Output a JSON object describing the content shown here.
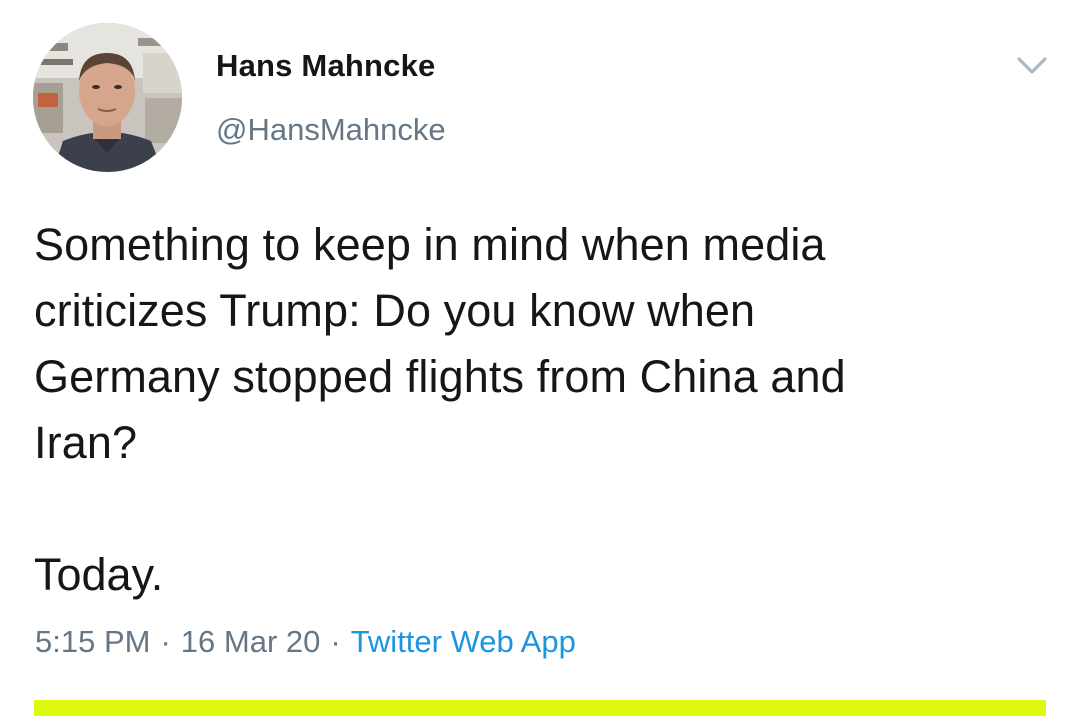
{
  "author": {
    "display_name": "Hans Mahncke",
    "handle": "@HansMahncke",
    "avatar_icon": "profile-photo"
  },
  "menu": {
    "icon": "chevron-down-icon",
    "color": "#aab8c2"
  },
  "tweet": {
    "text": "Something to keep in mind when media\ncriticizes Trump: Do you know when\nGermany stopped flights from China and\nIran?",
    "text_2": "Today."
  },
  "meta": {
    "time": "5:15 PM",
    "separator": "·",
    "date": "16 Mar 20",
    "source": "Twitter Web App"
  },
  "colors": {
    "text": "#14171a",
    "secondary": "#657786",
    "link": "#1b95e0",
    "highlight": "#ddf90e"
  }
}
